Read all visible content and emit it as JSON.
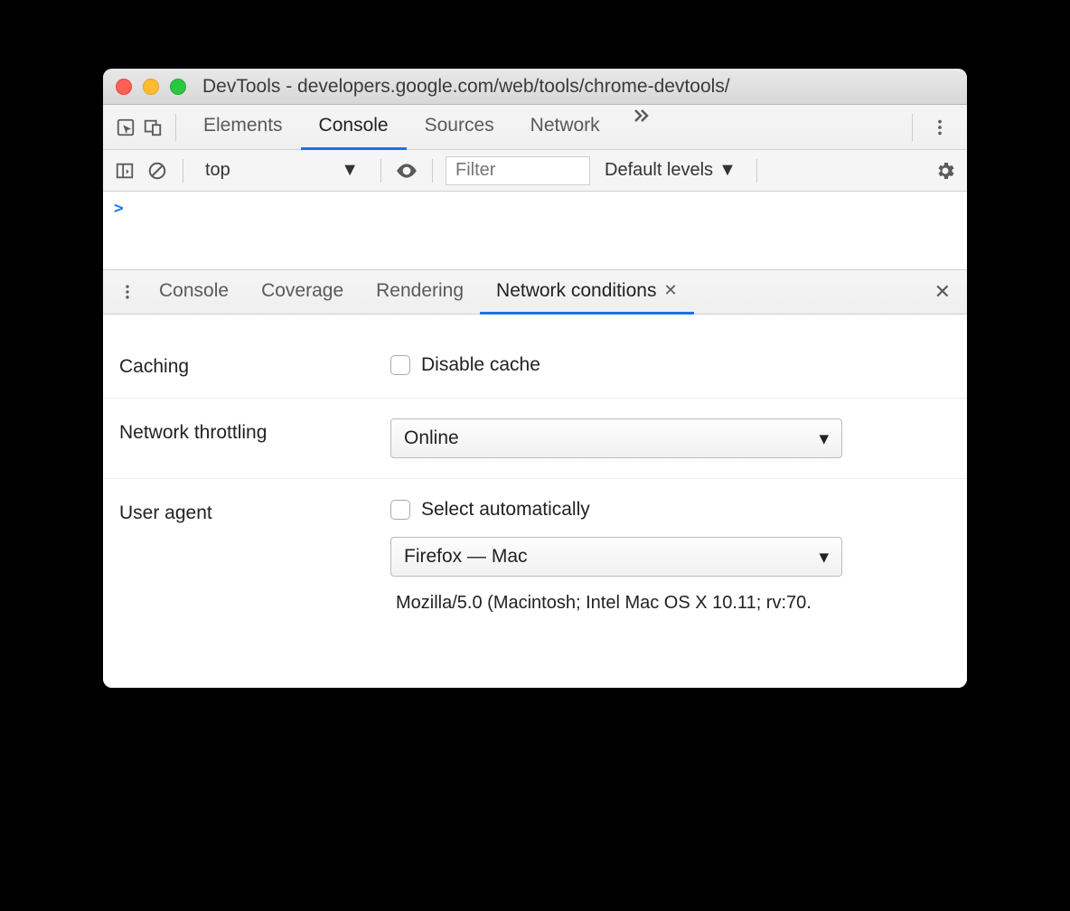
{
  "window": {
    "title": "DevTools - developers.google.com/web/tools/chrome-devtools/"
  },
  "mainTabs": {
    "items": [
      "Elements",
      "Console",
      "Sources",
      "Network"
    ],
    "activeIndex": 1
  },
  "consoleBar": {
    "context": "top",
    "filterPlaceholder": "Filter",
    "levels": "Default levels"
  },
  "consolePrompt": ">",
  "drawerTabs": {
    "items": [
      "Console",
      "Coverage",
      "Rendering",
      "Network conditions"
    ],
    "activeIndex": 3
  },
  "networkConditions": {
    "cachingLabel": "Caching",
    "disableCacheLabel": "Disable cache",
    "throttlingLabel": "Network throttling",
    "throttlingValue": "Online",
    "uaLabel": "User agent",
    "uaAutoLabel": "Select automatically",
    "uaPreset": "Firefox — Mac",
    "uaString": "Mozilla/5.0 (Macintosh; Intel Mac OS X 10.11; rv:70."
  }
}
